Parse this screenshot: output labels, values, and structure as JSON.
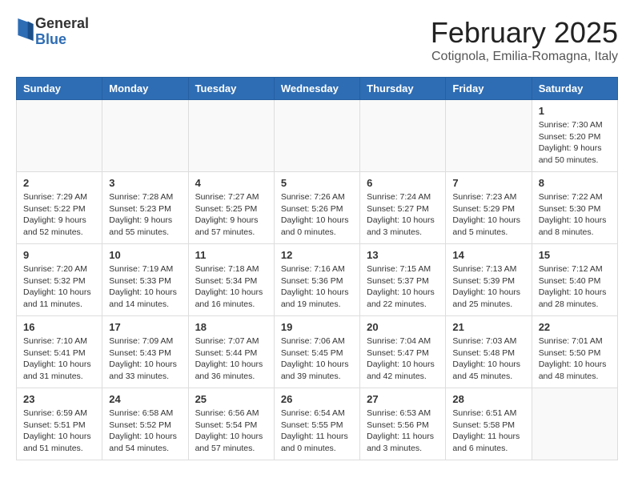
{
  "header": {
    "logo_general": "General",
    "logo_blue": "Blue",
    "title": "February 2025",
    "subtitle": "Cotignola, Emilia-Romagna, Italy"
  },
  "days_of_week": [
    "Sunday",
    "Monday",
    "Tuesday",
    "Wednesday",
    "Thursday",
    "Friday",
    "Saturday"
  ],
  "weeks": [
    [
      {
        "day": "",
        "info": ""
      },
      {
        "day": "",
        "info": ""
      },
      {
        "day": "",
        "info": ""
      },
      {
        "day": "",
        "info": ""
      },
      {
        "day": "",
        "info": ""
      },
      {
        "day": "",
        "info": ""
      },
      {
        "day": "1",
        "info": "Sunrise: 7:30 AM\nSunset: 5:20 PM\nDaylight: 9 hours and 50 minutes."
      }
    ],
    [
      {
        "day": "2",
        "info": "Sunrise: 7:29 AM\nSunset: 5:22 PM\nDaylight: 9 hours and 52 minutes."
      },
      {
        "day": "3",
        "info": "Sunrise: 7:28 AM\nSunset: 5:23 PM\nDaylight: 9 hours and 55 minutes."
      },
      {
        "day": "4",
        "info": "Sunrise: 7:27 AM\nSunset: 5:25 PM\nDaylight: 9 hours and 57 minutes."
      },
      {
        "day": "5",
        "info": "Sunrise: 7:26 AM\nSunset: 5:26 PM\nDaylight: 10 hours and 0 minutes."
      },
      {
        "day": "6",
        "info": "Sunrise: 7:24 AM\nSunset: 5:27 PM\nDaylight: 10 hours and 3 minutes."
      },
      {
        "day": "7",
        "info": "Sunrise: 7:23 AM\nSunset: 5:29 PM\nDaylight: 10 hours and 5 minutes."
      },
      {
        "day": "8",
        "info": "Sunrise: 7:22 AM\nSunset: 5:30 PM\nDaylight: 10 hours and 8 minutes."
      }
    ],
    [
      {
        "day": "9",
        "info": "Sunrise: 7:20 AM\nSunset: 5:32 PM\nDaylight: 10 hours and 11 minutes."
      },
      {
        "day": "10",
        "info": "Sunrise: 7:19 AM\nSunset: 5:33 PM\nDaylight: 10 hours and 14 minutes."
      },
      {
        "day": "11",
        "info": "Sunrise: 7:18 AM\nSunset: 5:34 PM\nDaylight: 10 hours and 16 minutes."
      },
      {
        "day": "12",
        "info": "Sunrise: 7:16 AM\nSunset: 5:36 PM\nDaylight: 10 hours and 19 minutes."
      },
      {
        "day": "13",
        "info": "Sunrise: 7:15 AM\nSunset: 5:37 PM\nDaylight: 10 hours and 22 minutes."
      },
      {
        "day": "14",
        "info": "Sunrise: 7:13 AM\nSunset: 5:39 PM\nDaylight: 10 hours and 25 minutes."
      },
      {
        "day": "15",
        "info": "Sunrise: 7:12 AM\nSunset: 5:40 PM\nDaylight: 10 hours and 28 minutes."
      }
    ],
    [
      {
        "day": "16",
        "info": "Sunrise: 7:10 AM\nSunset: 5:41 PM\nDaylight: 10 hours and 31 minutes."
      },
      {
        "day": "17",
        "info": "Sunrise: 7:09 AM\nSunset: 5:43 PM\nDaylight: 10 hours and 33 minutes."
      },
      {
        "day": "18",
        "info": "Sunrise: 7:07 AM\nSunset: 5:44 PM\nDaylight: 10 hours and 36 minutes."
      },
      {
        "day": "19",
        "info": "Sunrise: 7:06 AM\nSunset: 5:45 PM\nDaylight: 10 hours and 39 minutes."
      },
      {
        "day": "20",
        "info": "Sunrise: 7:04 AM\nSunset: 5:47 PM\nDaylight: 10 hours and 42 minutes."
      },
      {
        "day": "21",
        "info": "Sunrise: 7:03 AM\nSunset: 5:48 PM\nDaylight: 10 hours and 45 minutes."
      },
      {
        "day": "22",
        "info": "Sunrise: 7:01 AM\nSunset: 5:50 PM\nDaylight: 10 hours and 48 minutes."
      }
    ],
    [
      {
        "day": "23",
        "info": "Sunrise: 6:59 AM\nSunset: 5:51 PM\nDaylight: 10 hours and 51 minutes."
      },
      {
        "day": "24",
        "info": "Sunrise: 6:58 AM\nSunset: 5:52 PM\nDaylight: 10 hours and 54 minutes."
      },
      {
        "day": "25",
        "info": "Sunrise: 6:56 AM\nSunset: 5:54 PM\nDaylight: 10 hours and 57 minutes."
      },
      {
        "day": "26",
        "info": "Sunrise: 6:54 AM\nSunset: 5:55 PM\nDaylight: 11 hours and 0 minutes."
      },
      {
        "day": "27",
        "info": "Sunrise: 6:53 AM\nSunset: 5:56 PM\nDaylight: 11 hours and 3 minutes."
      },
      {
        "day": "28",
        "info": "Sunrise: 6:51 AM\nSunset: 5:58 PM\nDaylight: 11 hours and 6 minutes."
      },
      {
        "day": "",
        "info": ""
      }
    ]
  ]
}
